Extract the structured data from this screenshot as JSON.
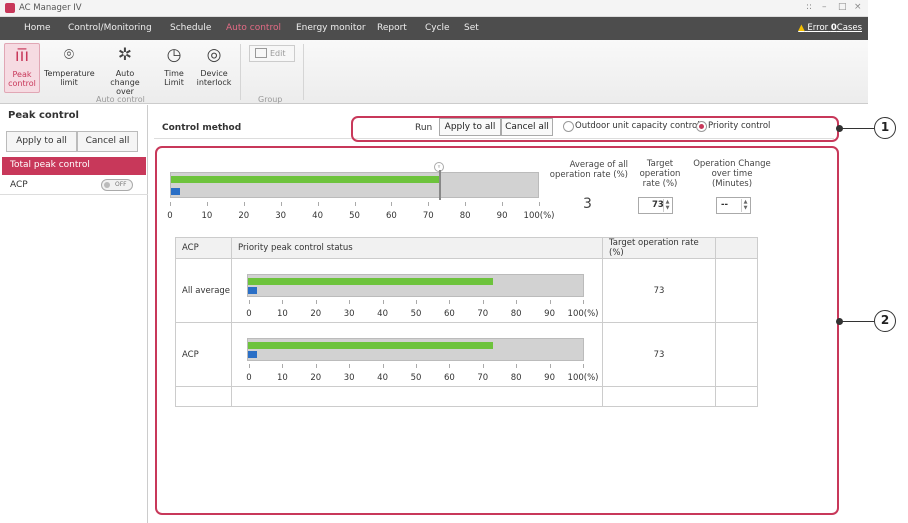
{
  "window": {
    "title": "AC Manager IV",
    "controls": [
      "::",
      "–",
      "□",
      "×"
    ]
  },
  "menu": {
    "items": [
      "Home",
      "Control/Monitoring",
      "Schedule",
      "Auto control",
      "Energy monitor",
      "Report",
      "Cycle",
      "Set"
    ],
    "active": "Auto control",
    "error_label": "Error",
    "error_count": "0",
    "error_unit": "Cases"
  },
  "ribbon": {
    "auto_control": {
      "caption": "Auto control",
      "buttons": [
        {
          "label": "Peak control",
          "icon": "peak-control-icon"
        },
        {
          "label": "Temperature limit",
          "icon": "temperature-limit-icon"
        },
        {
          "label": "Auto change over",
          "icon": "auto-change-over-icon"
        },
        {
          "label": "Time Limit",
          "icon": "time-limit-icon"
        },
        {
          "label": "Device interlock",
          "icon": "device-interlock-icon"
        }
      ]
    },
    "group": {
      "caption": "Group",
      "edit_label": "Edit"
    }
  },
  "sidebar": {
    "title": "Peak control",
    "apply_all": "Apply to all",
    "cancel_all": "Cancel all",
    "selected_item": "Total peak control",
    "items": [
      {
        "name": "ACP",
        "toggle": "OFF"
      }
    ]
  },
  "control": {
    "title": "Control method",
    "run_label": "Run",
    "apply_all": "Apply to all",
    "cancel_all": "Cancel all",
    "options": [
      "Outdoor unit capacity control",
      "Priority control"
    ],
    "selected_option": "Priority control"
  },
  "summary": {
    "avg_header": "Average of all operation rate (%)",
    "target_header": "Target operation rate (%)",
    "change_header": "Operation Change over time (Minutes)",
    "avg_value": "3",
    "target_value": "73",
    "change_value": "--",
    "bar_fill_percent": 73,
    "actual_percent": 3,
    "ticks": [
      "0",
      "10",
      "20",
      "30",
      "40",
      "50",
      "60",
      "70",
      "80",
      "90",
      "100(%)"
    ]
  },
  "table": {
    "headers": [
      "ACP",
      "Priority peak control status",
      "Target operation rate (%)",
      ""
    ],
    "rows": [
      {
        "name": "All average",
        "fill_percent": 73,
        "actual_percent": 3,
        "target": "73"
      },
      {
        "name": "ACP",
        "fill_percent": 73,
        "actual_percent": 3,
        "target": "73"
      }
    ]
  },
  "callouts": [
    "1",
    "2"
  ],
  "colors": {
    "accent": "#c8385a",
    "menu_bg": "#4d4d4d",
    "bar_green": "#6dc33c",
    "bar_blue": "#2a6fc6"
  }
}
